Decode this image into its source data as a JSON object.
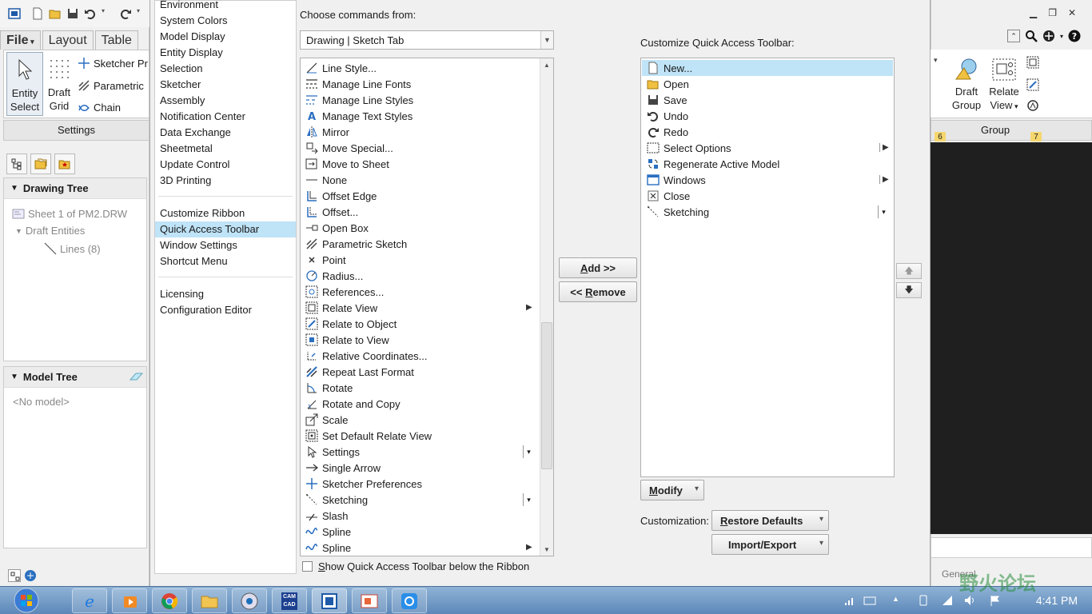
{
  "app": {
    "ribbon_tabs": [
      "File",
      "Layout",
      "Table"
    ],
    "ribbon": {
      "entity_select": "Entity\nSelect",
      "entity_select_l1": "Entity",
      "entity_select_l2": "Select",
      "draft_grid_l1": "Draft",
      "draft_grid_l2": "Grid",
      "sketcher_pref": "Sketcher Pr",
      "parametric": "Parametric",
      "chain": "Chain",
      "group_label": "Settings"
    },
    "drawing_tree": {
      "title": "Drawing Tree",
      "items": [
        "Sheet 1 of PM2.DRW",
        "Draft Entities",
        "Lines (8)"
      ]
    },
    "model_tree": {
      "title": "Model Tree",
      "empty": "<No model>"
    },
    "right_ribbon": {
      "draft_group_l1": "Draft",
      "draft_group_l2": "Group",
      "relate_view_l1": "Relate",
      "relate_view_l2": "View",
      "group_label": "Group",
      "badge_left": "6",
      "badge_right": "7"
    },
    "right_bottom_text": "General"
  },
  "dialog": {
    "categories_top": [
      "Environment",
      "System Colors",
      "Model Display",
      "Entity Display",
      "Selection",
      "Sketcher",
      "Assembly",
      "Notification Center",
      "Data Exchange",
      "Sheetmetal",
      "Update Control",
      "3D Printing"
    ],
    "categories_mid": [
      "Customize Ribbon",
      "Quick Access Toolbar",
      "Window Settings",
      "Shortcut Menu"
    ],
    "categories_bottom": [
      "Licensing",
      "Configuration Editor"
    ],
    "selected_category": "Quick Access Toolbar",
    "choose_label": "Choose commands from:",
    "choose_value": "Drawing | Sketch Tab",
    "commands": [
      {
        "label": "Line Style...",
        "icon": "line-style-icon"
      },
      {
        "label": "Manage Line Fonts",
        "icon": "line-fonts-icon"
      },
      {
        "label": "Manage Line Styles",
        "icon": "line-styles-icon"
      },
      {
        "label": "Manage Text Styles",
        "icon": "text-styles-icon"
      },
      {
        "label": "Mirror",
        "icon": "mirror-icon"
      },
      {
        "label": "Move Special...",
        "icon": "move-special-icon"
      },
      {
        "label": "Move to Sheet",
        "icon": "move-sheet-icon"
      },
      {
        "label": "None",
        "icon": "none-icon"
      },
      {
        "label": "Offset Edge",
        "icon": "offset-edge-icon"
      },
      {
        "label": "Offset...",
        "icon": "offset-icon"
      },
      {
        "label": "Open Box",
        "icon": "open-box-icon"
      },
      {
        "label": "Parametric Sketch",
        "icon": "parametric-sketch-icon"
      },
      {
        "label": "Point",
        "icon": "point-icon"
      },
      {
        "label": "Radius...",
        "icon": "radius-icon"
      },
      {
        "label": "References...",
        "icon": "references-icon"
      },
      {
        "label": "Relate View",
        "icon": "relate-view-icon",
        "submenu": true
      },
      {
        "label": "Relate to Object",
        "icon": "relate-object-icon"
      },
      {
        "label": "Relate to View",
        "icon": "relate-to-view-icon"
      },
      {
        "label": "Relative Coordinates...",
        "icon": "relative-coords-icon"
      },
      {
        "label": "Repeat Last Format",
        "icon": "repeat-format-icon"
      },
      {
        "label": "Rotate",
        "icon": "rotate-icon"
      },
      {
        "label": "Rotate and Copy",
        "icon": "rotate-copy-icon"
      },
      {
        "label": "Scale",
        "icon": "scale-icon"
      },
      {
        "label": "Set Default Relate View",
        "icon": "default-relate-icon"
      },
      {
        "label": "Settings",
        "icon": "settings-arrow-icon",
        "split": true
      },
      {
        "label": "Single Arrow",
        "icon": "single-arrow-icon"
      },
      {
        "label": "Sketcher Preferences",
        "icon": "sketcher-pref-icon"
      },
      {
        "label": "Sketching",
        "icon": "sketching-icon",
        "split": true
      },
      {
        "label": "Slash",
        "icon": "slash-icon"
      },
      {
        "label": "Spline",
        "icon": "spline-icon"
      },
      {
        "label": "Spline",
        "icon": "spline-icon",
        "submenu": true
      }
    ],
    "add_label": "Add >>",
    "add_mnemonic": "A",
    "add_rest": "dd >>",
    "remove_prefix": "<< ",
    "remove_mnemonic": "R",
    "remove_rest": "emove",
    "qat_label": "Customize Quick Access Toolbar:",
    "qat_items": [
      {
        "label": "New...",
        "icon": "new-icon",
        "selected": true
      },
      {
        "label": "Open",
        "icon": "open-folder-icon"
      },
      {
        "label": "Save",
        "icon": "save-icon"
      },
      {
        "label": "Undo",
        "icon": "undo-icon"
      },
      {
        "label": "Redo",
        "icon": "redo-icon"
      },
      {
        "label": "Select Options",
        "icon": "select-options-icon",
        "submenu": true
      },
      {
        "label": "Regenerate Active Model",
        "icon": "regenerate-icon"
      },
      {
        "label": "Windows",
        "icon": "windows-icon",
        "submenu": true
      },
      {
        "label": "Close",
        "icon": "close-icon"
      },
      {
        "label": "Sketching",
        "icon": "sketching-icon",
        "split": true
      }
    ],
    "modify_mnemonic": "M",
    "modify_rest": "odify",
    "customization_label": "Customization:",
    "restore_mnemonic": "R",
    "restore_rest": "estore Defaults",
    "import_export": "Import/Export",
    "show_below_label": "Show Quick Access Toolbar below the Ribbon",
    "show_below_mnemonic": "S",
    "show_below_rest": "how Quick Access Toolbar below the Ribbon"
  },
  "taskbar": {
    "time": "4:41 PM",
    "camcad_l1": "CAM",
    "camcad_l2": "CAD",
    "watermark": "野火论坛"
  },
  "colors": {
    "selection": "#bfe3f7",
    "taskbar": "#6f97c4"
  }
}
